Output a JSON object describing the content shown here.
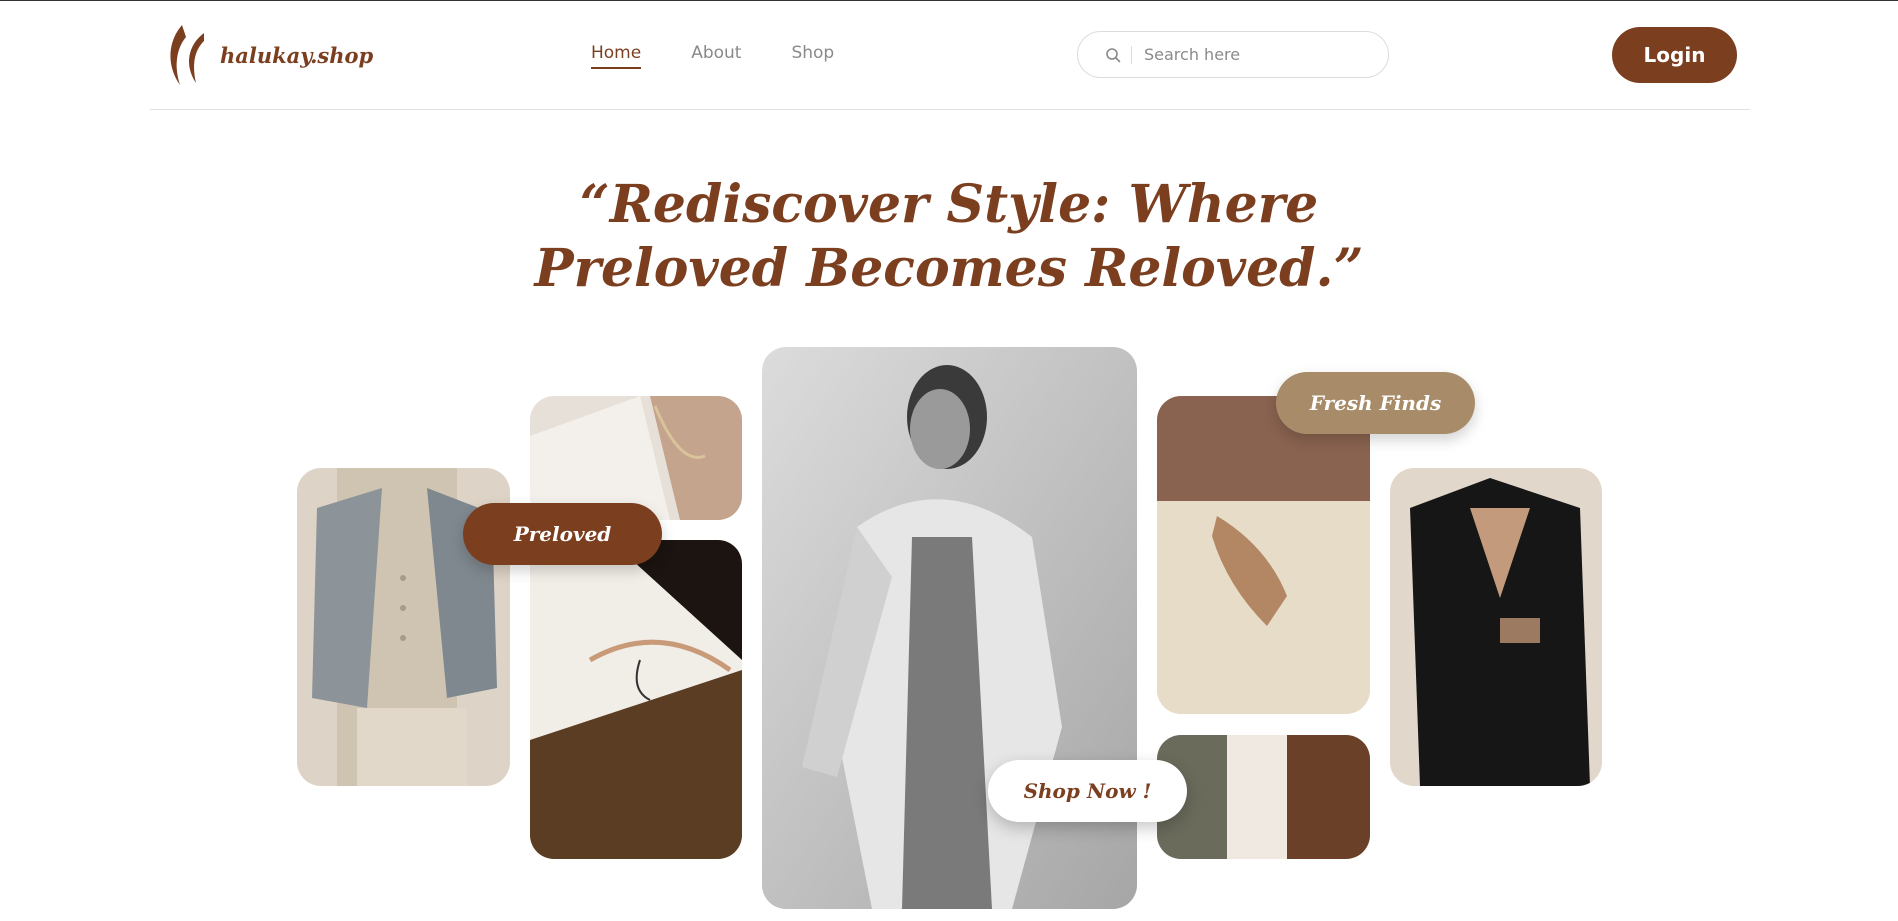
{
  "brand": {
    "name": "halukay.shop",
    "logo_icon": "swirl-logo-icon",
    "accent_color": "#7b3f20"
  },
  "nav": {
    "items": [
      {
        "label": "Home",
        "active": true
      },
      {
        "label": "About",
        "active": false
      },
      {
        "label": "Shop",
        "active": false
      }
    ]
  },
  "search": {
    "placeholder": "Search here",
    "value": "",
    "icon": "search-icon"
  },
  "login": {
    "label": "Login"
  },
  "hero": {
    "line1": "“Rediscover Style: Where",
    "line2": "Preloved Becomes Reloved.”"
  },
  "tags": {
    "preloved": "Preloved",
    "fresh": "Fresh Finds",
    "shop_now": "Shop Now !"
  },
  "colors": {
    "brown": "#7b3f20",
    "tan": "#a88c6a",
    "cream": "#e7dccd"
  }
}
